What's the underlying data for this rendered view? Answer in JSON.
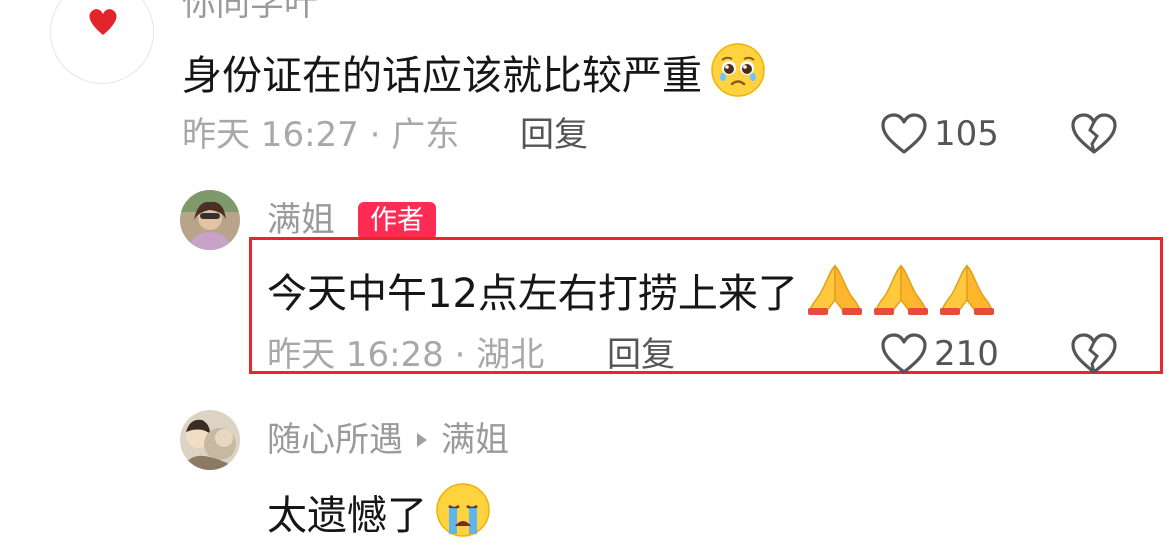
{
  "comments": [
    {
      "username": "你同学叶",
      "content": "身份证在的话应该就比较严重",
      "meta": "昨天 16:27 · 广东",
      "reply_label": "回复",
      "like_count": "105"
    },
    {
      "username": "满姐",
      "badge": "作者",
      "content": "今天中午12点左右打捞上来了",
      "meta": "昨天 16:28 · 湖北",
      "reply_label": "回复",
      "like_count": "210"
    },
    {
      "username": "随心所遇",
      "reply_to": "满姐",
      "content": "太遗憾了"
    }
  ],
  "colors": {
    "author_badge": "#fe2c55",
    "highlight_box": "#e8262d",
    "heart_avatar": "#e3242b"
  },
  "icons": {
    "like": "heart-outline-icon",
    "dislike": "broken-heart-icon",
    "reply_arrow": "triangle-right-icon"
  }
}
